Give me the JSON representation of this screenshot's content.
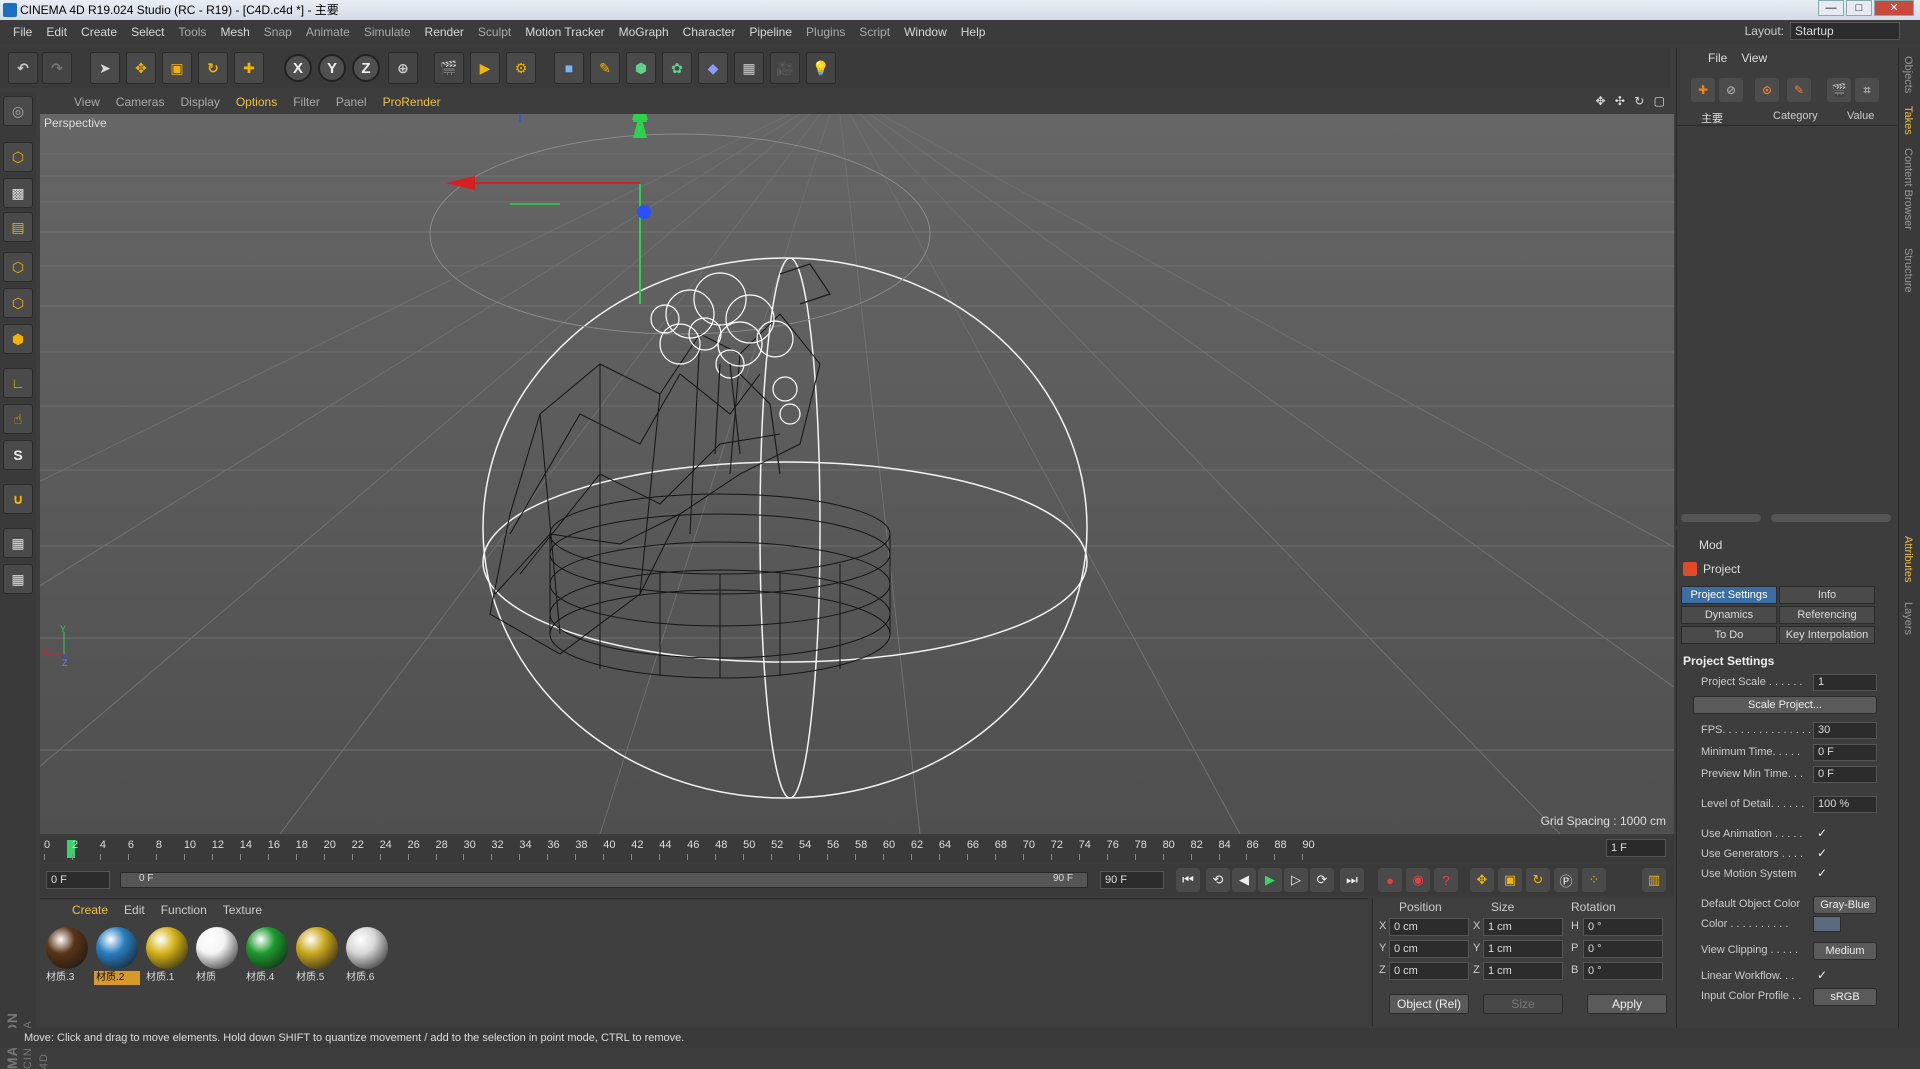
{
  "window": {
    "title": "CINEMA 4D R19.024 Studio (RC - R19) - [C4D.c4d *] - 主要",
    "min": "—",
    "max": "□",
    "close": "✕"
  },
  "menu": [
    "File",
    "Edit",
    "Create",
    "Select",
    "Tools",
    "Mesh",
    "Snap",
    "Animate",
    "Simulate",
    "Render",
    "Sculpt",
    "Motion Tracker",
    "MoGraph",
    "Character",
    "Pipeline",
    "Plugins",
    "Script",
    "Window",
    "Help"
  ],
  "layout": {
    "label": "Layout:",
    "value": "Startup"
  },
  "toolbar": {
    "x_label": "X",
    "y_label": "Y",
    "z_label": "Z"
  },
  "viewport": {
    "menu": [
      "View",
      "Cameras",
      "Display",
      "Options",
      "Filter",
      "Panel",
      "ProRender"
    ],
    "active_menu": "Options",
    "camera_label": "Perspective",
    "grid_spacing": "Grid Spacing : 1000 cm",
    "nav_icons": "✥ ✣ ↻ ▢",
    "axis_x": "X",
    "axis_y": "Y",
    "axis_z": "Z"
  },
  "timeline": {
    "ticks": [
      "0",
      "2",
      "4",
      "6",
      "8",
      "10",
      "12",
      "14",
      "16",
      "18",
      "20",
      "22",
      "24",
      "26",
      "28",
      "30",
      "32",
      "34",
      "36",
      "38",
      "40",
      "42",
      "44",
      "46",
      "48",
      "50",
      "52",
      "54",
      "56",
      "58",
      "60",
      "62",
      "64",
      "66",
      "68",
      "70",
      "72",
      "74",
      "76",
      "78",
      "80",
      "82",
      "84",
      "86",
      "88",
      "90"
    ],
    "current_frame_box": "1 F"
  },
  "transport": {
    "start": "0 F",
    "range_start": "0 F",
    "range_end": "90 F",
    "end": "90 F"
  },
  "materials": {
    "menu": [
      "Create",
      "Edit",
      "Function",
      "Texture"
    ],
    "items": [
      {
        "label": "材质.3",
        "color": "#5a3518",
        "selected": false
      },
      {
        "label": "材质.2",
        "color": "#2a7fc0",
        "selected": true
      },
      {
        "label": "材质.1",
        "color": "#d4b41a",
        "selected": false
      },
      {
        "label": "材质",
        "color": "#f4f4f4",
        "selected": false
      },
      {
        "label": "材质.4",
        "color": "#1e9a2e",
        "selected": false
      },
      {
        "label": "材质.5",
        "color": "#c9a820",
        "selected": false
      },
      {
        "label": "材质.6",
        "color": "#d8d8d8",
        "selected": false
      }
    ]
  },
  "coords": {
    "headers": {
      "position": "Position",
      "size": "Size",
      "rotation": "Rotation"
    },
    "rows": [
      {
        "axis": "X",
        "pos": "0 cm",
        "saxis": "X",
        "size": "1 cm",
        "raxis": "H",
        "rot": "0 °"
      },
      {
        "axis": "Y",
        "pos": "0 cm",
        "saxis": "Y",
        "size": "1 cm",
        "raxis": "P",
        "rot": "0 °"
      },
      {
        "axis": "Z",
        "pos": "0 cm",
        "saxis": "Z",
        "size": "1 cm",
        "raxis": "B",
        "rot": "0 °"
      }
    ],
    "mode": "Object (Rel)",
    "size_mode": "Size",
    "apply": "Apply"
  },
  "status": "Move: Click and drag to move elements. Hold down SHIFT to quantize movement / add to the selection in point mode, CTRL to remove.",
  "objects": {
    "menu": [
      "File",
      "View"
    ],
    "root": "主要",
    "col_category": "Category",
    "col_value": "Value"
  },
  "side_tabs": [
    "Objects",
    "Takes",
    "Content Browser",
    "Structure",
    "Attributes",
    "Layers"
  ],
  "attributes": {
    "mode": "Mod",
    "object": "Project",
    "tabs": [
      "Project Settings",
      "Info",
      "Dynamics",
      "Referencing",
      "To Do",
      "Key Interpolation"
    ],
    "section": "Project Settings",
    "scale_label": "Project Scale . . . . . .",
    "scale_value": "1",
    "scale_button": "Scale Project...",
    "fps_label": "FPS. . . . . . . . . . . . . . .",
    "fps_value": "30",
    "min_time_label": "Minimum Time. . . . .",
    "min_time_value": "0 F",
    "preview_min_label": "Preview Min Time. . .",
    "preview_min_value": "0 F",
    "lod_label": "Level of Detail. . . . . .",
    "lod_value": "100 %",
    "use_animation": "Use Animation . . . . .",
    "use_generators": "Use Generators . . . .",
    "use_motion": "Use Motion System",
    "default_color_label": "Default Object Color",
    "default_color_value": "Gray-Blue",
    "color_label": "Color . . . . . . . . . .",
    "view_clipping_label": "View Clipping . . . . .",
    "view_clipping_value": "Medium",
    "linear_workflow": "Linear Workflow. . .",
    "input_profile_label": "Input Color Profile . .",
    "input_profile_value": "sRGB",
    "check": "✓"
  }
}
